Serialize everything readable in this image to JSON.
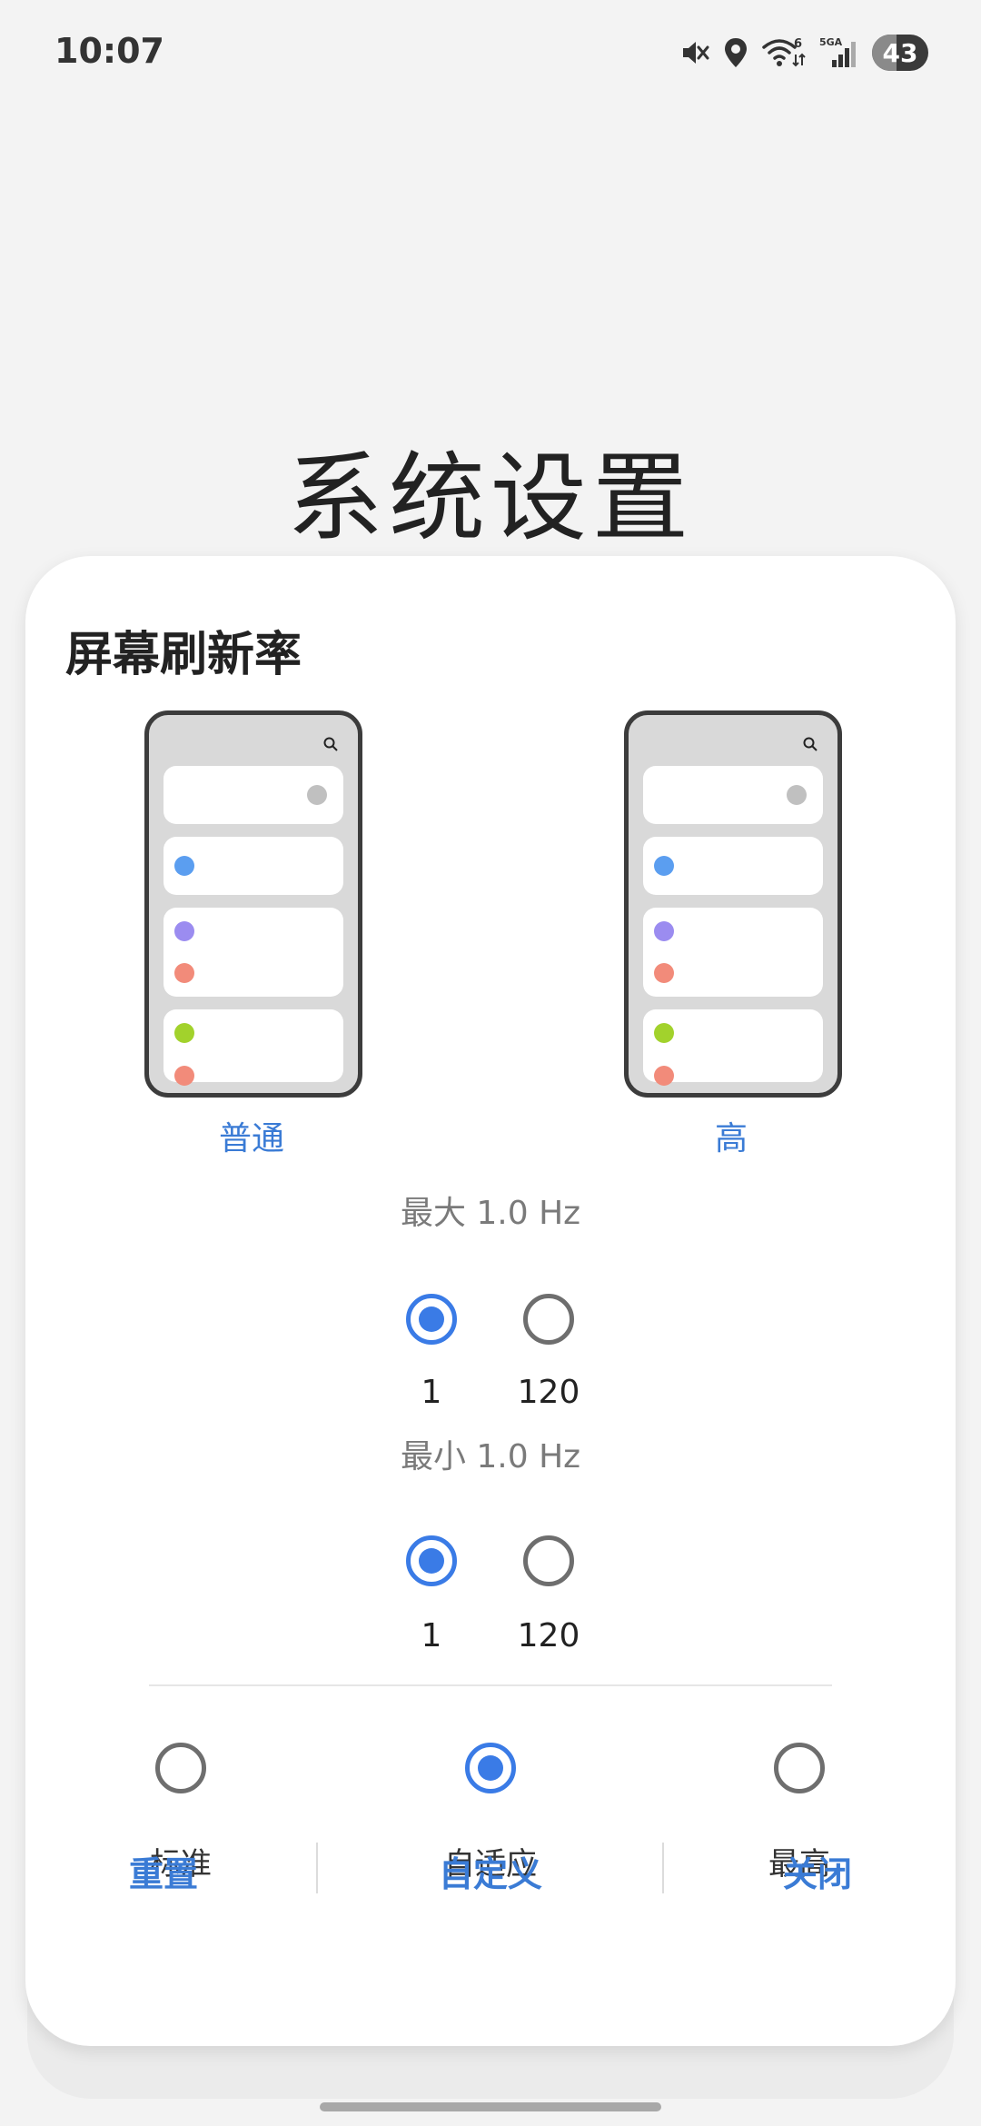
{
  "status_bar": {
    "time": "10:07",
    "icons": [
      "mute-icon",
      "location-icon",
      "wifi-6-icon",
      "5ga-signal-icon"
    ],
    "network": "5GA",
    "wifi_badge": "6",
    "battery": "43",
    "battery_level_percent": 43
  },
  "page": {
    "title": "系统设置"
  },
  "dialog": {
    "title": "屏幕刷新率",
    "previews": [
      {
        "label": "普通",
        "icon": "phone-preview-icon"
      },
      {
        "label": "高",
        "icon": "phone-preview-icon"
      }
    ],
    "max": {
      "label": "最大 1.0 Hz",
      "options": [
        "1",
        "120"
      ],
      "selected": "1"
    },
    "min": {
      "label": "最小 1.0 Hz",
      "options": [
        "1",
        "120"
      ],
      "selected": "1"
    },
    "modes": [
      {
        "label": "标准",
        "selected": false
      },
      {
        "label": "自适应",
        "selected": true
      },
      {
        "label": "最高",
        "selected": false
      }
    ],
    "actions": {
      "reset": "重置",
      "custom": "自定义",
      "close": "关闭"
    }
  },
  "colors": {
    "accent": "#3a7be6",
    "link": "#3a7bd5",
    "dot_blue": "#5b9ef0",
    "dot_purple": "#9b8cf0",
    "dot_red": "#f28b7a",
    "dot_green": "#a2d22c"
  }
}
